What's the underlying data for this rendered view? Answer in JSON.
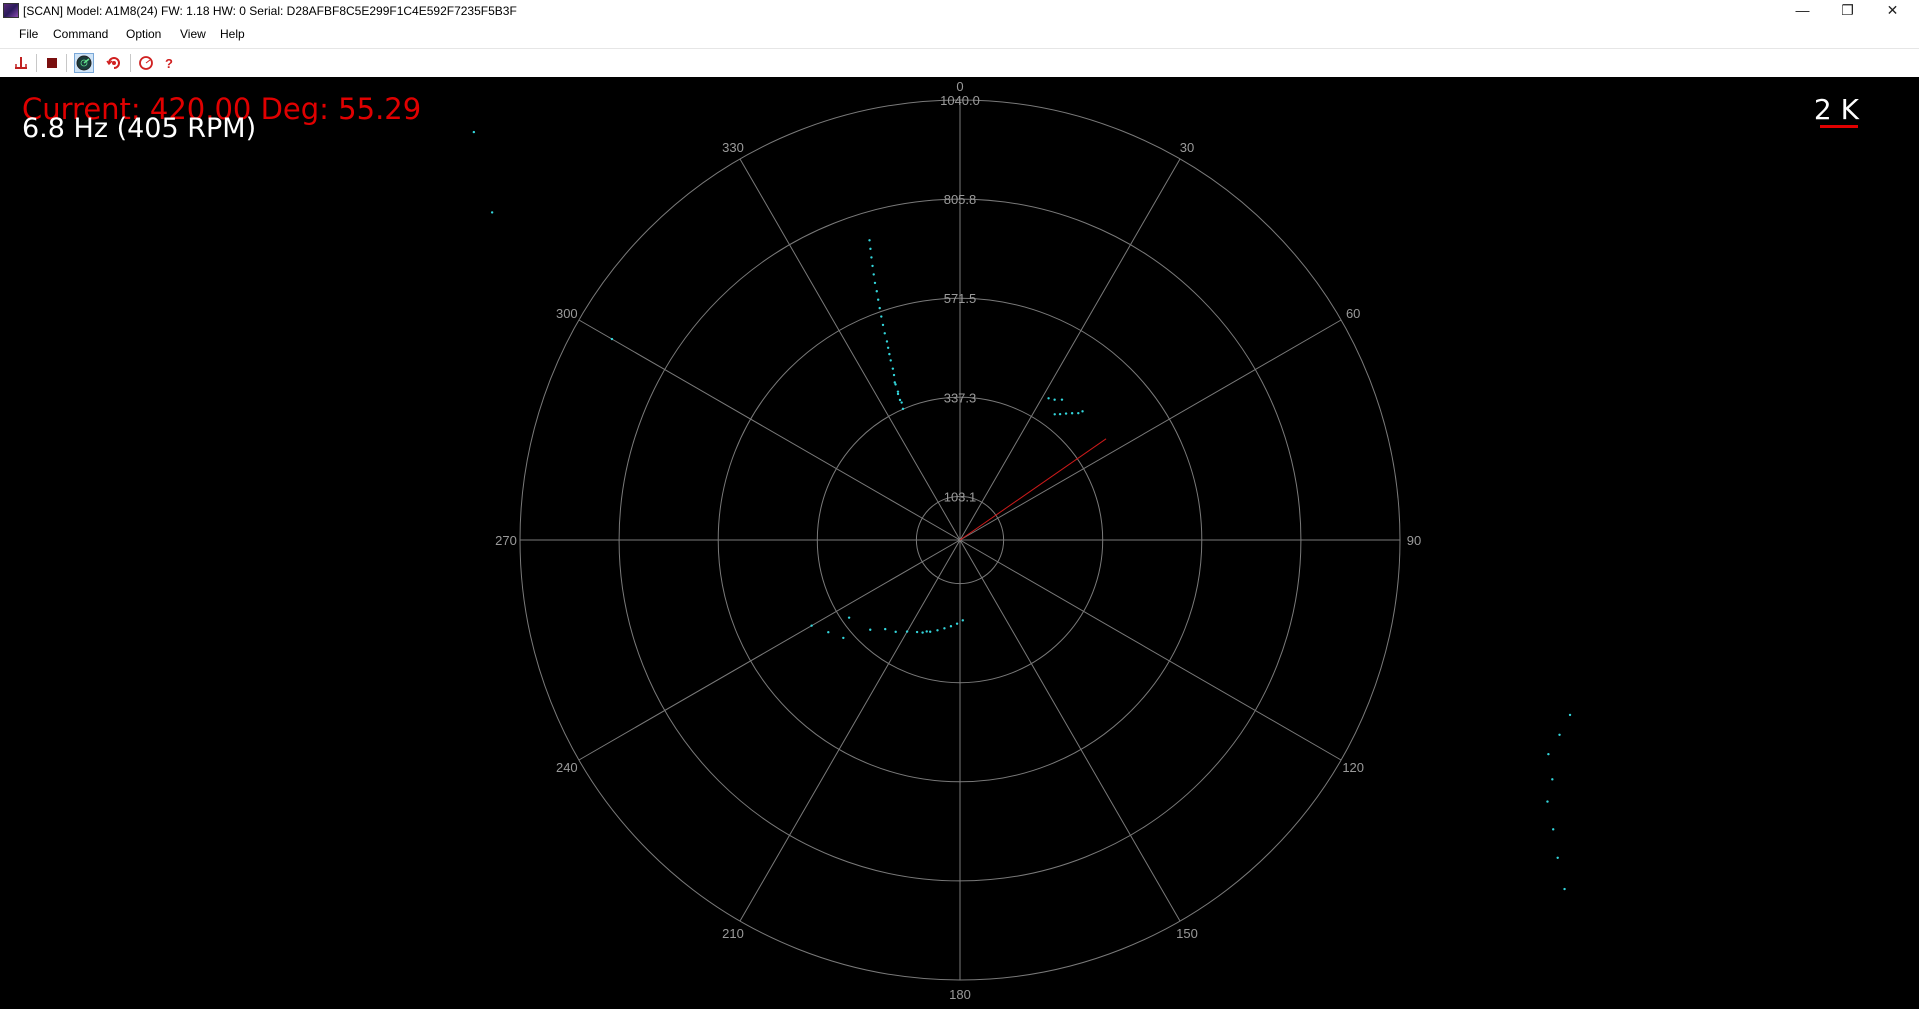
{
  "window": {
    "title": "[SCAN] Model: A1M8(24) FW: 1.18 HW: 0 Serial: D28AFBF8C5E299F1C4E592F7235F5B3F",
    "min_glyph": "—",
    "max_glyph": "❐",
    "close_glyph": "✕"
  },
  "menu": {
    "file": "File",
    "command": "Command",
    "option": "Option",
    "view": "View",
    "help": "Help"
  },
  "toolbar": {
    "icons": [
      "start-scan-icon",
      "stop-icon",
      "radar-view-icon",
      "reset-icon",
      "circle-view-icon",
      "help-icon"
    ],
    "help_glyph": "?"
  },
  "scan": {
    "current_text": "Current: 420.00 Deg: 55.29",
    "current_distance": 420.0,
    "current_degree": 55.29,
    "rate_text": "6.8 Hz (405 RPM)",
    "scale_label": "2 K",
    "colors": {
      "points": "#33d6dc",
      "current_ray": "#cc1a1a",
      "status": "#e00000",
      "grid": "#7a7a7a"
    },
    "rings": [
      "103.1",
      "337.3",
      "571.5",
      "805.8",
      "1040.0"
    ],
    "ring_values": [
      103.1,
      337.3,
      571.5,
      805.8,
      1040.0
    ],
    "angle_labels": [
      "0",
      "30",
      "60",
      "90",
      "120",
      "150",
      "180",
      "210",
      "240",
      "270",
      "300",
      "330"
    ],
    "points": [
      [
        336.5,
        338
      ],
      [
        337,
        353
      ],
      [
        336.8,
        360
      ],
      [
        337,
        375
      ],
      [
        337.3,
        380
      ],
      [
        337.5,
        398
      ],
      [
        337.5,
        403
      ],
      [
        338.2,
        420
      ],
      [
        338.6,
        435
      ],
      [
        338.9,
        455
      ],
      [
        339.2,
        470
      ],
      [
        339.5,
        485
      ],
      [
        339.8,
        500
      ],
      [
        340.0,
        520
      ],
      [
        340.3,
        540
      ],
      [
        340.6,
        560
      ],
      [
        340.9,
        580
      ],
      [
        341.2,
        600
      ],
      [
        341.5,
        620
      ],
      [
        341.7,
        640
      ],
      [
        342.0,
        660
      ],
      [
        342.3,
        680
      ],
      [
        342.6,
        700
      ],
      [
        342.9,
        720
      ],
      [
        343.2,
        740
      ],
      [
        43.6,
        420
      ],
      [
        43.0,
        410
      ],
      [
        41.5,
        400
      ],
      [
        40.0,
        390
      ],
      [
        38.5,
        380
      ],
      [
        37.0,
        372
      ],
      [
        36.0,
        410
      ],
      [
        34.0,
        400
      ],
      [
        32.0,
        395
      ],
      [
        200,
        230
      ],
      [
        205,
        240
      ],
      [
        210,
        250
      ],
      [
        215,
        265
      ],
      [
        220,
        275
      ],
      [
        225,
        300
      ],
      [
        235,
        320
      ],
      [
        178,
        190
      ],
      [
        182,
        198
      ],
      [
        186,
        205
      ],
      [
        190,
        212
      ],
      [
        194,
        220
      ],
      [
        198,
        228
      ],
      [
        202,
        236
      ],
      [
        230,
        360
      ],
      [
        235,
        380
      ],
      [
        240,
        405
      ],
      [
        106,
        1500
      ],
      [
        108,
        1490
      ],
      [
        110,
        1480
      ],
      [
        112,
        1510
      ],
      [
        114,
        1520
      ],
      [
        116,
        1560
      ],
      [
        118,
        1600
      ],
      [
        120,
        1650
      ],
      [
        300,
        950
      ],
      [
        305,
        1350
      ],
      [
        310,
        1500
      ]
    ]
  }
}
